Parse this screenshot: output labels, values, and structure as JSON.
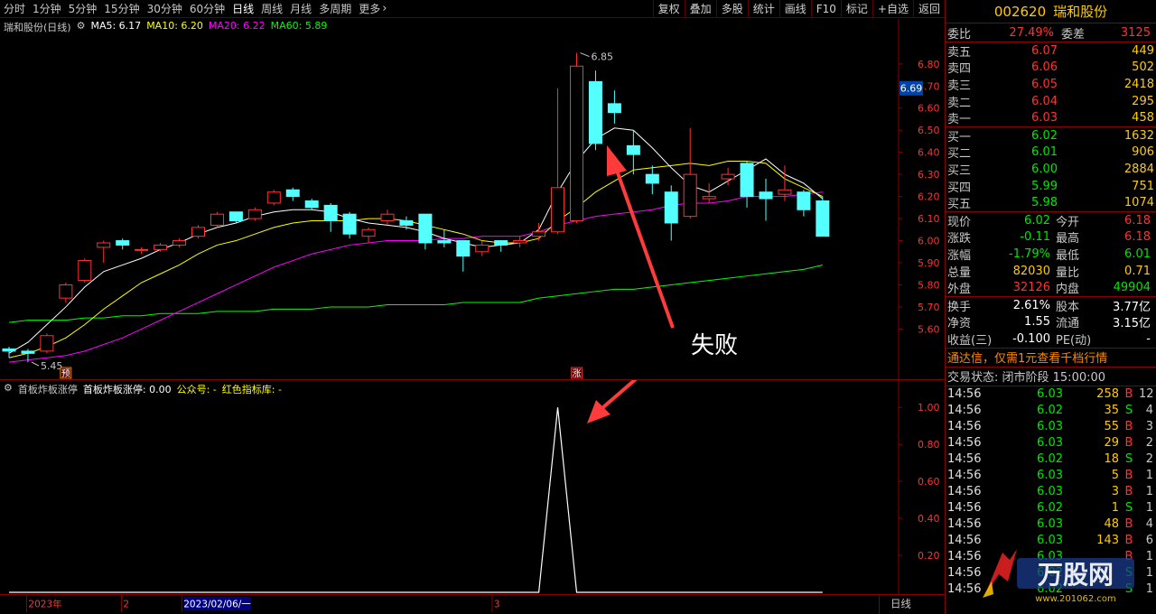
{
  "toolbar": {
    "timeframes": [
      "分时",
      "1分钟",
      "5分钟",
      "15分钟",
      "30分钟",
      "60分钟",
      "日线",
      "周线",
      "月线",
      "多周期",
      "更多"
    ],
    "active": "日线",
    "more_icon": "chevron-right-icon",
    "buttons": [
      "复权",
      "叠加",
      "多股",
      "统计",
      "画线",
      "F10",
      "标记",
      "+自选",
      "返回"
    ]
  },
  "legend": {
    "title": "瑞和股份(日线)",
    "ma5": "MA5: 6.17",
    "ma10": "MA10: 6.20",
    "ma20": "MA20: 6.22",
    "ma60": "MA60: 5.89",
    "colors": {
      "ma5": "#ffffff",
      "ma10": "#ffff00",
      "ma20": "#ff00ff",
      "ma60": "#00ff00"
    }
  },
  "indicator_legend": {
    "name": "首板炸板涨停",
    "value": "首板炸板涨停: 0.00",
    "public": "公众号: -",
    "lib": "红色指标库: -"
  },
  "annotations": {
    "fail_label": "失败",
    "high_label": "6.85",
    "low_label": "5.45",
    "pre_tag": "预",
    "limit_tag": "涨",
    "current_price_tag": "6.69"
  },
  "axes": {
    "price_ticks": [
      "6.80",
      "6.70",
      "6.60",
      "6.50",
      "6.40",
      "6.30",
      "6.20",
      "6.10",
      "6.00",
      "5.90",
      "5.80",
      "5.70",
      "5.60"
    ],
    "indicator_ticks": [
      "1.00",
      "0.80",
      "0.60",
      "0.40",
      "0.20"
    ],
    "date_labels": [
      "2023年",
      "2",
      "2023/02/06/一",
      "3"
    ],
    "period": "日线"
  },
  "chart_data": {
    "type": "candlestick",
    "ylim": [
      5.43,
      6.93
    ],
    "candles": [
      [
        5.51,
        5.52,
        5.47,
        5.5
      ],
      [
        5.5,
        5.51,
        5.45,
        5.49
      ],
      [
        5.5,
        5.58,
        5.49,
        5.57
      ],
      [
        5.74,
        5.81,
        5.72,
        5.8
      ],
      [
        5.82,
        5.92,
        5.81,
        5.91
      ],
      [
        5.97,
        6.0,
        5.9,
        5.99
      ],
      [
        6.0,
        6.01,
        5.96,
        5.98
      ],
      [
        5.96,
        5.97,
        5.94,
        5.96
      ],
      [
        5.96,
        5.99,
        5.95,
        5.98
      ],
      [
        5.98,
        6.01,
        5.97,
        6.0
      ],
      [
        6.02,
        6.07,
        6.01,
        6.06
      ],
      [
        6.07,
        6.13,
        6.06,
        6.12
      ],
      [
        6.13,
        6.12,
        6.08,
        6.09
      ],
      [
        6.1,
        6.15,
        6.09,
        6.14
      ],
      [
        6.17,
        6.23,
        6.16,
        6.22
      ],
      [
        6.23,
        6.24,
        6.18,
        6.2
      ],
      [
        6.18,
        6.19,
        6.14,
        6.15
      ],
      [
        6.16,
        6.17,
        6.04,
        6.09
      ],
      [
        6.12,
        6.13,
        6.01,
        6.03
      ],
      [
        6.02,
        6.06,
        5.99,
        6.05
      ],
      [
        6.09,
        6.14,
        6.07,
        6.12
      ],
      [
        6.09,
        6.11,
        6.05,
        6.07
      ],
      [
        6.12,
        6.11,
        5.96,
        5.99
      ],
      [
        6.0,
        6.05,
        5.97,
        5.99
      ],
      [
        6.0,
        6.0,
        5.86,
        5.93
      ],
      [
        5.95,
        6.0,
        5.93,
        5.98
      ],
      [
        6.0,
        6.0,
        5.95,
        5.98
      ],
      [
        5.99,
        6.02,
        5.97,
        6.0
      ],
      [
        6.02,
        6.08,
        6.0,
        6.04
      ],
      [
        6.04,
        6.69,
        6.03,
        6.24
      ],
      [
        6.09,
        6.85,
        6.08,
        6.79
      ],
      [
        6.72,
        6.77,
        6.41,
        6.44
      ],
      [
        6.62,
        6.68,
        6.53,
        6.58
      ],
      [
        6.43,
        6.5,
        6.3,
        6.39
      ],
      [
        6.3,
        6.34,
        6.21,
        6.26
      ],
      [
        6.22,
        6.25,
        6.0,
        6.08
      ],
      [
        6.11,
        6.51,
        6.1,
        6.3
      ],
      [
        6.19,
        6.26,
        6.17,
        6.2
      ],
      [
        6.28,
        6.33,
        6.25,
        6.3
      ],
      [
        6.35,
        6.36,
        6.15,
        6.2
      ],
      [
        6.22,
        6.28,
        6.09,
        6.19
      ],
      [
        6.21,
        6.34,
        6.18,
        6.23
      ],
      [
        6.22,
        6.23,
        6.11,
        6.14
      ],
      [
        6.18,
        6.2,
        6.02,
        6.02
      ]
    ],
    "ma5": [
      5.47,
      5.49,
      5.54,
      5.62,
      5.7,
      5.79,
      5.86,
      5.89,
      5.92,
      5.96,
      5.99,
      6.03,
      6.06,
      6.08,
      6.11,
      6.13,
      6.14,
      6.14,
      6.13,
      6.1,
      6.08,
      6.07,
      6.06,
      6.04,
      6.01,
      5.99,
      5.97,
      5.98,
      5.99,
      6.05,
      6.22,
      6.36,
      6.46,
      6.51,
      6.5,
      6.42,
      6.33,
      6.25,
      6.22,
      6.27,
      6.32,
      6.37,
      6.3,
      6.26,
      6.19
    ],
    "ma10": [
      5.46,
      5.47,
      5.49,
      5.52,
      5.56,
      5.62,
      5.69,
      5.75,
      5.81,
      5.85,
      5.89,
      5.94,
      5.98,
      6.0,
      6.03,
      6.06,
      6.08,
      6.09,
      6.09,
      6.09,
      6.1,
      6.1,
      6.09,
      6.07,
      6.05,
      6.03,
      6.0,
      5.99,
      5.99,
      6.01,
      6.09,
      6.15,
      6.22,
      6.27,
      6.32,
      6.33,
      6.34,
      6.35,
      6.34,
      6.36,
      6.36,
      6.35,
      6.28,
      6.24,
      6.2
    ],
    "ma20": [
      5.44,
      5.45,
      5.46,
      5.47,
      5.48,
      5.5,
      5.53,
      5.56,
      5.6,
      5.64,
      5.68,
      5.72,
      5.76,
      5.8,
      5.84,
      5.88,
      5.91,
      5.94,
      5.96,
      5.98,
      5.99,
      6.0,
      6.0,
      6.0,
      6.01,
      6.01,
      6.02,
      6.02,
      6.02,
      6.04,
      6.07,
      6.09,
      6.11,
      6.12,
      6.13,
      6.14,
      6.16,
      6.17,
      6.17,
      6.18,
      6.2,
      6.2,
      6.2,
      6.21,
      6.22
    ],
    "ma60": [
      5.63,
      5.63,
      5.64,
      5.64,
      5.64,
      5.65,
      5.65,
      5.66,
      5.66,
      5.67,
      5.67,
      5.67,
      5.68,
      5.68,
      5.68,
      5.69,
      5.69,
      5.69,
      5.7,
      5.7,
      5.7,
      5.71,
      5.71,
      5.71,
      5.71,
      5.72,
      5.72,
      5.72,
      5.72,
      5.74,
      5.75,
      5.76,
      5.77,
      5.78,
      5.78,
      5.79,
      5.8,
      5.81,
      5.82,
      5.83,
      5.84,
      5.85,
      5.86,
      5.87,
      5.89
    ],
    "indicator": {
      "ylim": [
        0,
        1.05
      ],
      "values": [
        0,
        0,
        0,
        0,
        0,
        0,
        0,
        0,
        0,
        0,
        0,
        0,
        0,
        0,
        0,
        0,
        0,
        0,
        0,
        0,
        0,
        0,
        0,
        0,
        0,
        0,
        0,
        0,
        0,
        1,
        0,
        0,
        0,
        0,
        0,
        0,
        0,
        0,
        0,
        0,
        0,
        0,
        0,
        0
      ]
    }
  },
  "panel": {
    "code": "002620",
    "name": "瑞和股份",
    "weibi_label": "委比",
    "weibi": "27.49%",
    "weicha_label": "委差",
    "weicha": "3125",
    "asks": [
      {
        "label": "卖五",
        "price": "6.07",
        "vol": "449"
      },
      {
        "label": "卖四",
        "price": "6.06",
        "vol": "502"
      },
      {
        "label": "卖三",
        "price": "6.05",
        "vol": "2418"
      },
      {
        "label": "卖二",
        "price": "6.04",
        "vol": "295"
      },
      {
        "label": "卖一",
        "price": "6.03",
        "vol": "458"
      }
    ],
    "bids": [
      {
        "label": "买一",
        "price": "6.02",
        "vol": "1632"
      },
      {
        "label": "买二",
        "price": "6.01",
        "vol": "906"
      },
      {
        "label": "买三",
        "price": "6.00",
        "vol": "2884"
      },
      {
        "label": "买四",
        "price": "5.99",
        "vol": "751"
      },
      {
        "label": "买五",
        "price": "5.98",
        "vol": "1074"
      }
    ],
    "stats": [
      {
        "l1": "现价",
        "v1": "6.02",
        "c1": "green",
        "l2": "今开",
        "v2": "6.18",
        "c2": "red"
      },
      {
        "l1": "涨跌",
        "v1": "-0.11",
        "c1": "green",
        "l2": "最高",
        "v2": "6.18",
        "c2": "red"
      },
      {
        "l1": "涨幅",
        "v1": "-1.79%",
        "c1": "green",
        "l2": "最低",
        "v2": "6.01",
        "c2": "green"
      },
      {
        "l1": "总量",
        "v1": "82030",
        "c1": "yellow",
        "l2": "量比",
        "v2": "0.71",
        "c2": "yellow"
      },
      {
        "l1": "外盘",
        "v1": "32126",
        "c1": "red",
        "l2": "内盘",
        "v2": "49904",
        "c2": "green"
      }
    ],
    "stats2": [
      {
        "l1": "换手",
        "v1": "2.61%",
        "l2": "股本",
        "v2": "3.77亿"
      },
      {
        "l1": "净资",
        "v1": "1.55",
        "l2": "流通",
        "v2": "3.15亿"
      },
      {
        "l1": "收益(三)",
        "v1": "-0.100",
        "l2": "PE(动)",
        "v2": "-"
      }
    ],
    "promo": "通达信，仅需1元查看千档行情",
    "status": "交易状态: 闭市阶段 15:00:00",
    "trades": [
      {
        "t": "14:56",
        "p": "6.03",
        "v": "258",
        "bs": "B",
        "n": "12"
      },
      {
        "t": "14:56",
        "p": "6.02",
        "v": "35",
        "bs": "S",
        "n": "4"
      },
      {
        "t": "14:56",
        "p": "6.03",
        "v": "55",
        "bs": "B",
        "n": "3"
      },
      {
        "t": "14:56",
        "p": "6.03",
        "v": "29",
        "bs": "B",
        "n": "2"
      },
      {
        "t": "14:56",
        "p": "6.02",
        "v": "18",
        "bs": "S",
        "n": "2"
      },
      {
        "t": "14:56",
        "p": "6.03",
        "v": "5",
        "bs": "B",
        "n": "1"
      },
      {
        "t": "14:56",
        "p": "6.03",
        "v": "3",
        "bs": "B",
        "n": "1"
      },
      {
        "t": "14:56",
        "p": "6.02",
        "v": "1",
        "bs": "S",
        "n": "1"
      },
      {
        "t": "14:56",
        "p": "6.03",
        "v": "48",
        "bs": "B",
        "n": "4"
      },
      {
        "t": "14:56",
        "p": "6.03",
        "v": "143",
        "bs": "B",
        "n": "6"
      },
      {
        "t": "14:56",
        "p": "6.03",
        "v": "",
        "bs": "B",
        "n": "1"
      },
      {
        "t": "14:56",
        "p": "6.02",
        "v": "",
        "bs": "S",
        "n": "1"
      },
      {
        "t": "14:56",
        "p": "6.02",
        "v": "",
        "bs": "S",
        "n": "1"
      }
    ],
    "watermark_text": "万股网",
    "watermark_url": "www.201062.com"
  }
}
